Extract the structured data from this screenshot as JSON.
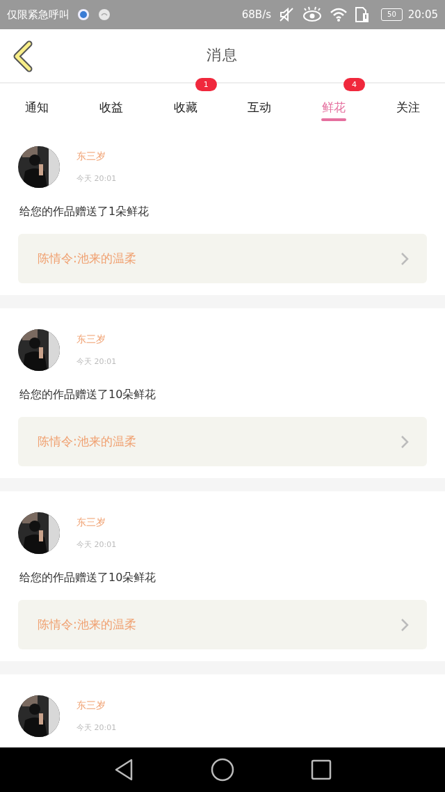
{
  "status_bar": {
    "carrier": "仅限紧急呼叫",
    "speed": "68B/s",
    "battery": "50",
    "time": "20:05"
  },
  "header": {
    "title": "消息"
  },
  "tabs": [
    {
      "label": "通知",
      "selected": false
    },
    {
      "label": "收益",
      "selected": false
    },
    {
      "label": "收藏",
      "selected": false,
      "badge": "1"
    },
    {
      "label": "互动",
      "selected": false
    },
    {
      "label": "鲜花",
      "selected": true,
      "badge": "4"
    },
    {
      "label": "关注",
      "selected": false
    }
  ],
  "messages": [
    {
      "user": "东三岁",
      "time": "今天 20:01",
      "text": "给您的作品赠送了1朵鲜花",
      "work": "陈情令:池来的温柔"
    },
    {
      "user": "东三岁",
      "time": "今天 20:01",
      "text": "给您的作品赠送了10朵鲜花",
      "work": "陈情令:池来的温柔"
    },
    {
      "user": "东三岁",
      "time": "今天 20:01",
      "text": "给您的作品赠送了10朵鲜花",
      "work": "陈情令:池来的温柔"
    },
    {
      "user": "东三岁",
      "time": "今天 20:01"
    }
  ]
}
